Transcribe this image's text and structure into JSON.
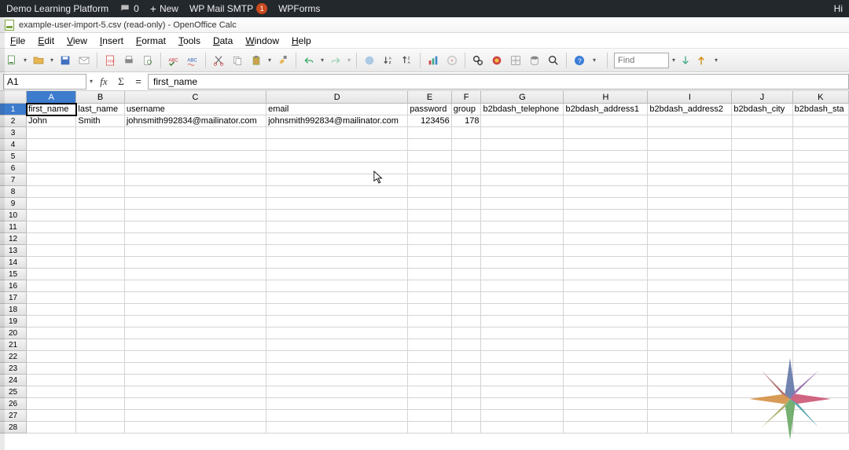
{
  "wpbar": {
    "site": "Demo Learning Platform",
    "comments": "0",
    "new": "New",
    "mail": "WP Mail SMTP",
    "mailBadge": "1",
    "forms": "WPForms",
    "right": "Hi"
  },
  "window": {
    "title": "example-user-import-5.csv (read-only) - OpenOffice Calc"
  },
  "menus": [
    "File",
    "Edit",
    "View",
    "Insert",
    "Format",
    "Tools",
    "Data",
    "Window",
    "Help"
  ],
  "find": {
    "placeholder": "Find"
  },
  "cellRef": "A1",
  "formulaValue": "first_name",
  "columns": [
    {
      "label": "A",
      "w": 64
    },
    {
      "label": "B",
      "w": 62
    },
    {
      "label": "C",
      "w": 182
    },
    {
      "label": "D",
      "w": 182
    },
    {
      "label": "E",
      "w": 56
    },
    {
      "label": "F",
      "w": 38
    },
    {
      "label": "G",
      "w": 106
    },
    {
      "label": "H",
      "w": 108
    },
    {
      "label": "I",
      "w": 108
    },
    {
      "label": "J",
      "w": 78
    },
    {
      "label": "K",
      "w": 72
    }
  ],
  "headerRow": [
    "first_name",
    "last_name",
    "username",
    "email",
    "password",
    "group",
    "b2bdash_telephone",
    "b2bdash_address1",
    "b2bdash_address2",
    "b2bdash_city",
    "b2bdash_sta"
  ],
  "dataRow": [
    "John",
    "Smith",
    "johnsmith992834@mailinator.com",
    "johnsmith992834@mailinator.com",
    "123456",
    "178",
    "",
    "",
    "",
    "",
    ""
  ],
  "totalRows": 28
}
